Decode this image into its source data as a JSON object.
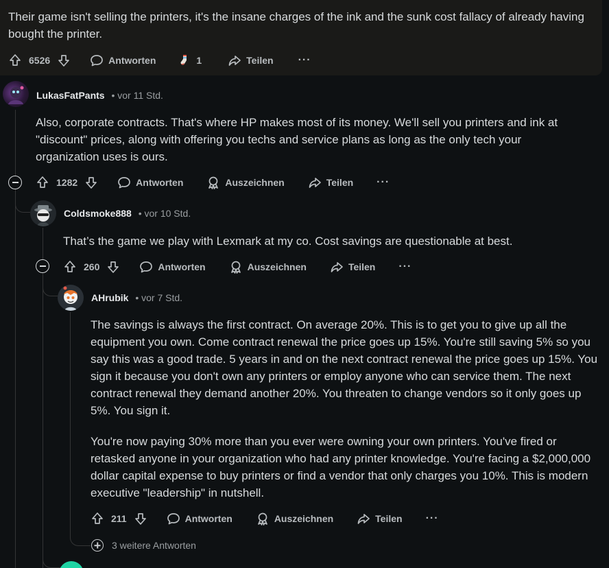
{
  "top_comment": {
    "text": "Their game isn't selling the printers, it's the insane charges of the ink and the sunk cost fallacy of already having bought the printer.",
    "votes": "6526",
    "reply_label": "Antworten",
    "award_count": "1",
    "share_label": "Teilen",
    "more_label": "···"
  },
  "comments": [
    {
      "author": "LukasFatPants",
      "time": "• vor 11 Std.",
      "text": "Also, corporate contracts. That's where HP makes most of its money. We'll sell you printers and ink at \"discount\" prices, along with offering you techs and service plans as long as the only tech your organization uses is ours.",
      "votes": "1282",
      "reply_label": "Antworten",
      "award_label": "Auszeichnen",
      "share_label": "Teilen",
      "more_label": "···"
    },
    {
      "author": "Coldsmoke888",
      "time": "• vor 10 Std.",
      "text": "That’s the game we play with Lexmark at my co. Cost savings are questionable at best.",
      "votes": "260",
      "reply_label": "Antworten",
      "award_label": "Auszeichnen",
      "share_label": "Teilen",
      "more_label": "···"
    },
    {
      "author": "AHrubik",
      "time": "• vor 7 Std.",
      "text_p1": "The savings is always the first contract. On average 20%. This is to get you to give up all the equipment you own. Come contract renewal the price goes up 15%. You're still saving 5% so you say this was a good trade. 5 years in and on the next contract renewal the price goes up 15%. You sign it because you don't own any printers or employ anyone who can service them. The next contract renewal they demand another 20%. You threaten to change vendors so it only goes up 5%. You sign it.",
      "text_p2": "You're now paying 30% more than you ever were owning your own printers. You've fired or retasked anyone in your organization who had any printer knowledge. You're facing a $2,000,000 dollar capital expense to buy printers or find a vendor that only charges you 10%. This is modern executive \"leadership\" in nutshell.",
      "votes": "211",
      "reply_label": "Antworten",
      "award_label": "Auszeichnen",
      "share_label": "Teilen",
      "more_label": "···"
    }
  ],
  "more_replies_label": "3 weitere Antworten",
  "colors": {
    "background": "#0e1113",
    "card": "#1a1a18",
    "text": "#d7dadc",
    "muted": "#9a9ea1",
    "thread": "#343536"
  }
}
